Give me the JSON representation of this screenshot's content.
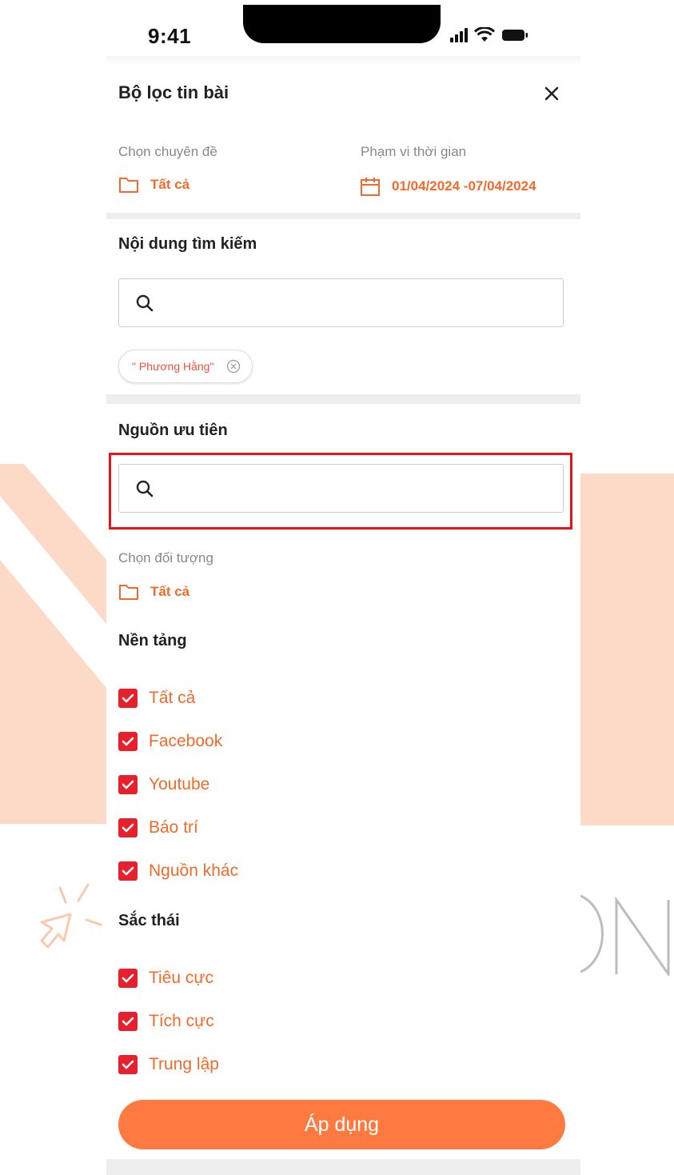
{
  "status_bar": {
    "time": "9:41"
  },
  "header": {
    "title": "Bộ lọc tin bài"
  },
  "filters": {
    "topic_label": "Chọn chuyên đề",
    "topic_value": "Tất cả",
    "time_label": "Phạm vi thời gian",
    "time_value": "01/04/2024 -07/04/2024"
  },
  "search_content": {
    "title": "Nội dung tìm kiếm",
    "placeholder": "",
    "tags": [
      {
        "label": "\" Phương Hằng\""
      }
    ]
  },
  "priority_source": {
    "title": "Nguồn ưu tiên",
    "placeholder": ""
  },
  "target": {
    "label": "Chọn đối tượng",
    "value": "Tất cả"
  },
  "platform": {
    "title": "Nền tảng",
    "options": [
      {
        "label": "Tất cả",
        "checked": true
      },
      {
        "label": "Facebook",
        "checked": true
      },
      {
        "label": "Youtube",
        "checked": true
      },
      {
        "label": "Báo trí",
        "checked": true
      },
      {
        "label": "Nguồn khác",
        "checked": true
      }
    ]
  },
  "sentiment": {
    "title": "Sắc thái",
    "options": [
      {
        "label": "Tiêu cực",
        "checked": true
      },
      {
        "label": "Tích cực",
        "checked": true
      },
      {
        "label": "Trung lập",
        "checked": true
      }
    ]
  },
  "apply_button": "Áp dụng",
  "colors": {
    "accent": "#f36a2a",
    "button": "#ff7a40",
    "checkbox": "#e8202c",
    "highlight": "#e3141c"
  }
}
